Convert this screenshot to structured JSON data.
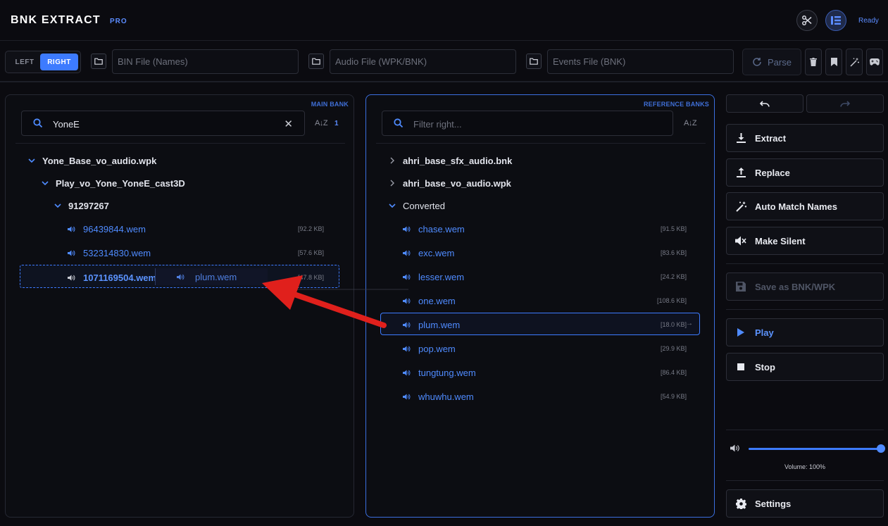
{
  "header": {
    "title": "BNK EXTRACT",
    "badge": "PRO",
    "status": "Ready",
    "icons": [
      "scissors-icon",
      "layout-icon"
    ]
  },
  "toolbar": {
    "side_left": "LEFT",
    "side_right": "RIGHT",
    "selected_side": "RIGHT",
    "bin_placeholder": "BIN File (Names)",
    "audio_placeholder": "Audio File (WPK/BNK)",
    "events_placeholder": "Events File (BNK)",
    "parse_label": "Parse",
    "tool_icons": [
      "trash-icon",
      "bookmark-icon",
      "wand-icon",
      "gamepad-icon"
    ]
  },
  "left_panel": {
    "tag": "MAIN BANK",
    "search_value": "YoneE",
    "sort_label": "A↓Z",
    "match_count": "1",
    "tree": {
      "bank": "Yone_Base_vo_audio.wpk",
      "event": "Play_vo_Yone_YoneE_cast3D",
      "id": "91297267",
      "files": [
        {
          "name": "96439844.wem",
          "size": "[92.2 KB]"
        },
        {
          "name": "532314830.wem",
          "size": "[57.6 KB]"
        },
        {
          "name": "1071169504.wem",
          "size": "[47.8 KB]"
        }
      ]
    },
    "drag_ghost": "plum.wem"
  },
  "right_panel": {
    "tag": "REFERENCE BANKS",
    "search_placeholder": "Filter right...",
    "sort_label": "A↓Z",
    "folders": [
      "ahri_base_sfx_audio.bnk",
      "ahri_base_vo_audio.wpk",
      "Converted"
    ],
    "files": [
      {
        "name": "chase.wem",
        "size": "[91.5 KB]"
      },
      {
        "name": "exc.wem",
        "size": "[83.6 KB]"
      },
      {
        "name": "lesser.wem",
        "size": "[24.2 KB]"
      },
      {
        "name": "one.wem",
        "size": "[108.6 KB]"
      },
      {
        "name": "plum.wem",
        "size": "[18.0 KB]"
      },
      {
        "name": "pop.wem",
        "size": "[29.9 KB]"
      },
      {
        "name": "tungtung.wem",
        "size": "[86.4 KB]"
      },
      {
        "name": "whuwhu.wem",
        "size": "[54.9 KB]"
      }
    ],
    "selected_file": "plum.wem"
  },
  "actions": {
    "extract": "Extract",
    "replace": "Replace",
    "auto_match": "Auto Match Names",
    "make_silent": "Make Silent",
    "save_as": "Save as BNK/WPK",
    "play": "Play",
    "stop": "Stop",
    "settings": "Settings"
  },
  "volume": {
    "label": "Volume: 100%",
    "level": 1.0
  },
  "colors": {
    "accent": "#3d7bff",
    "background": "#0b0b10",
    "drag_arrow": "#e0201c"
  }
}
